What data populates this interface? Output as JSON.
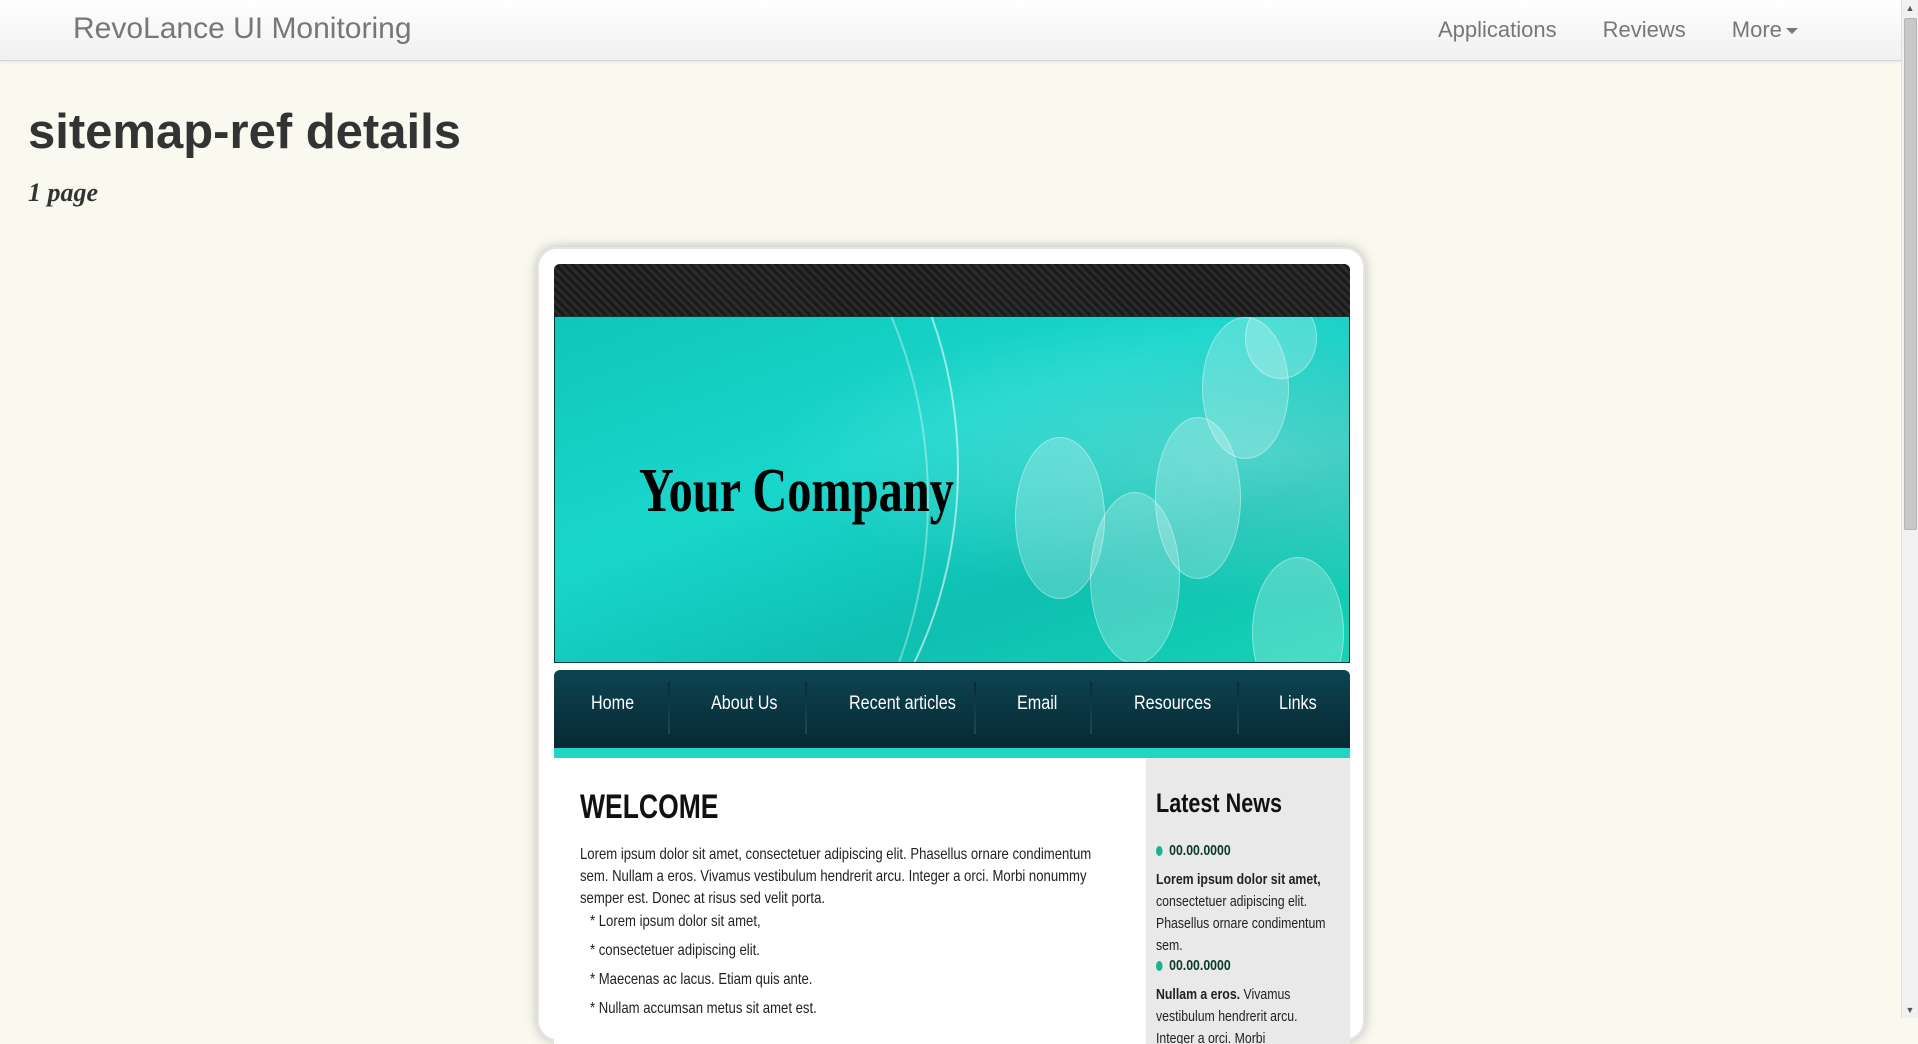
{
  "navbar": {
    "brand": "RevoLance UI Monitoring",
    "links": [
      "Applications",
      "Reviews",
      "More"
    ]
  },
  "page": {
    "title": "sitemap-ref details",
    "subtitle": "1 page"
  },
  "preview": {
    "company": "Your Company",
    "menu": [
      "Home",
      "About Us",
      "Recent articles",
      "Email",
      "Resources",
      "Links"
    ],
    "welcome": "WELCOME",
    "intro": "Lorem ipsum dolor sit amet, consectetuer adipiscing elit. Phasellus ornare condimentum sem. Nullam a eros. Vivamus vestibulum hendrerit arcu. Integer a orci. Morbi nonummy semper est. Donec at risus sed velit porta.",
    "bullets": [
      "* Lorem ipsum dolor sit amet,",
      "* consectetuer adipiscing elit.",
      "* Maecenas ac lacus. Etiam quis ante.",
      "* Nullam accumsan metus sit amet est."
    ],
    "news": {
      "title": "Latest News",
      "items": [
        {
          "date": "00.00.0000",
          "bold": "Lorem ipsum dolor sit amet,",
          "text": "consectetuer adipiscing elit. Phasellus ornare condimentum sem."
        },
        {
          "date": "00.00.0000",
          "bold": "Nullam a eros.",
          "text": "Vivamus vestibulum hendrerit arcu. Integer a orci. Morbi"
        }
      ]
    },
    "accent_color": "#1fd6c0",
    "menu_color": "#0a3642"
  }
}
